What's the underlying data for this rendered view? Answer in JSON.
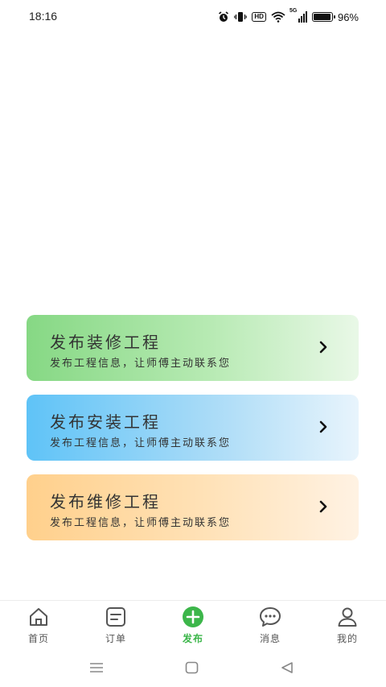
{
  "status_bar": {
    "time": "18:16",
    "hd_label": "HD",
    "network_label": "5G",
    "battery_percent": "96%",
    "icons": [
      "alarm-icon",
      "vibrate-icon",
      "hd-icon",
      "wifi-icon",
      "signal-icon",
      "battery-icon"
    ]
  },
  "cards": [
    {
      "title": "发布装修工程",
      "subtitle": "发布工程信息，让师傅主动联系您",
      "color": "#86d884"
    },
    {
      "title": "发布安装工程",
      "subtitle": "发布工程信息，让师傅主动联系您",
      "color": "#5fc3f7"
    },
    {
      "title": "发布维修工程",
      "subtitle": "发布工程信息，让师傅主动联系您",
      "color": "#ffd08c"
    }
  ],
  "tabs": [
    {
      "label": "首页",
      "icon": "home-icon"
    },
    {
      "label": "订单",
      "icon": "order-icon"
    },
    {
      "label": "发布",
      "icon": "plus-icon",
      "active": true
    },
    {
      "label": "消息",
      "icon": "chat-icon"
    },
    {
      "label": "我的",
      "icon": "user-icon"
    }
  ],
  "colors": {
    "accent": "#3cb64a",
    "tab_inactive": "#555555"
  },
  "nav_bar": {
    "buttons": [
      "menu-icon",
      "home-square-icon",
      "back-triangle-icon"
    ]
  }
}
